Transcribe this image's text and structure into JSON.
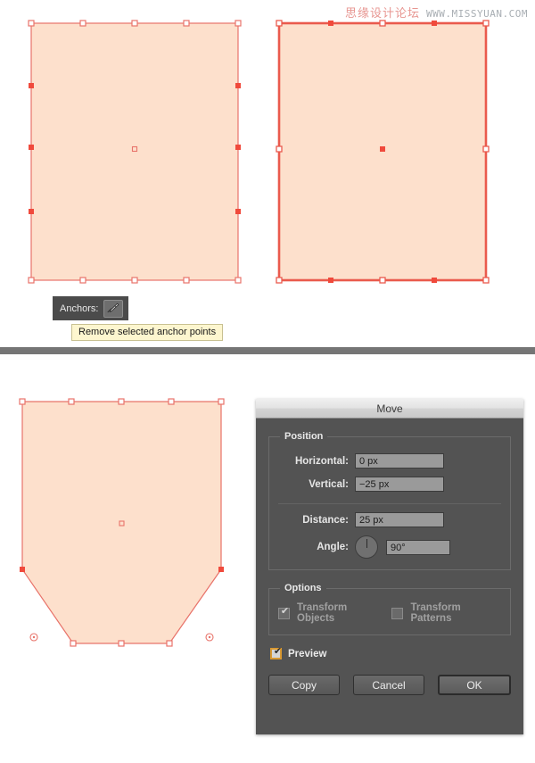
{
  "watermark": {
    "cn_text": "思缘设计论坛",
    "url_text": "WWW.MISSYUAN.COM"
  },
  "artwork": {
    "fill_color": "#fde0cc",
    "stroke_color": "#e8736a",
    "anchor_fill_selected": "#f04a3c",
    "anchor_fill_unselected": "#ffffff",
    "shape1_name": "rectangle-all-anchors",
    "shape2_name": "rectangle-selected-anchors",
    "shape3_name": "polygon-chamfered-bottom"
  },
  "anchors_panel": {
    "label": "Anchors:",
    "button_icon": "remove-anchor-point-pen-icon",
    "tooltip": "Remove selected anchor points"
  },
  "move_dialog": {
    "title": "Move",
    "position_group": {
      "legend": "Position",
      "horizontal_label": "Horizontal:",
      "horizontal_value": "0 px",
      "vertical_label": "Vertical:",
      "vertical_value": "−25 px",
      "distance_label": "Distance:",
      "distance_value": "25 px",
      "angle_label": "Angle:",
      "angle_value": "90°"
    },
    "options_group": {
      "legend": "Options",
      "transform_objects_label": "Transform Objects",
      "transform_objects_checked": true,
      "transform_patterns_label": "Transform Patterns",
      "transform_patterns_checked": false
    },
    "preview_label": "Preview",
    "preview_checked": true,
    "buttons": {
      "copy": "Copy",
      "cancel": "Cancel",
      "ok": "OK"
    },
    "accent_focus_color": "#d99932"
  }
}
